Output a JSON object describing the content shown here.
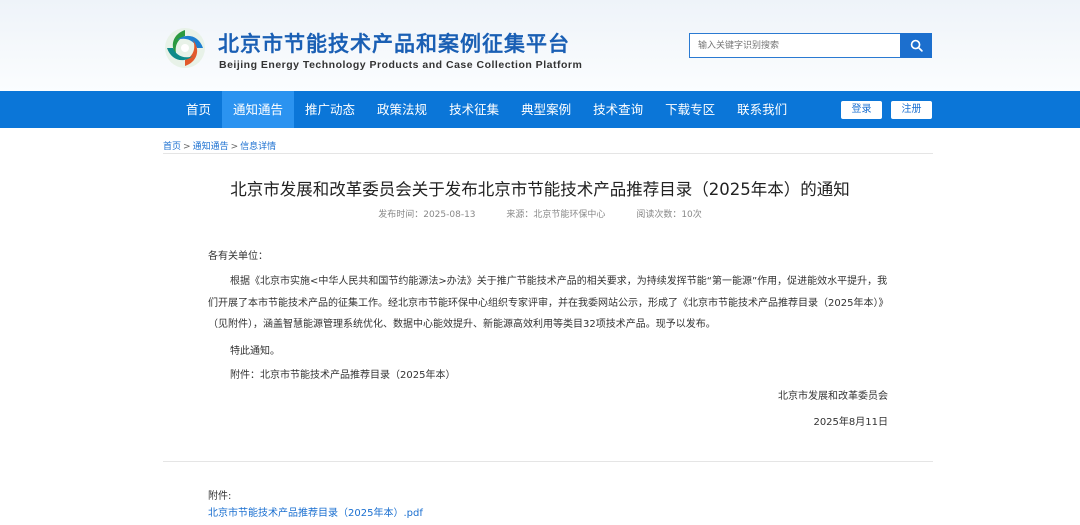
{
  "header": {
    "site_title": "北京市节能技术产品和案例征集平台",
    "site_subtitle": "Beijing Energy Technology Products and Case Collection Platform",
    "search_placeholder": "输入关键字识别搜索",
    "brand_color": "#1a5fb4"
  },
  "nav": {
    "items": [
      {
        "label": "首页",
        "active": false
      },
      {
        "label": "通知通告",
        "active": true
      },
      {
        "label": "推广动态",
        "active": false
      },
      {
        "label": "政策法规",
        "active": false
      },
      {
        "label": "技术征集",
        "active": false
      },
      {
        "label": "典型案例",
        "active": false
      },
      {
        "label": "技术查询",
        "active": false
      },
      {
        "label": "下载专区",
        "active": false
      },
      {
        "label": "联系我们",
        "active": false
      }
    ],
    "login_label": "登录",
    "register_label": "注册",
    "bar_color": "#0b76d8"
  },
  "breadcrumb": {
    "home": "首页",
    "section": "通知通告",
    "current": "信息详情",
    "separator": ">"
  },
  "article": {
    "title": "北京市发展和改革委员会关于发布北京市节能技术产品推荐目录（2025年本）的通知",
    "publish_time": "发布时间：2025-08-13",
    "source": "来源：北京节能环保中心",
    "views": "阅读次数：10次",
    "salutation": "各有关单位：",
    "body": "根据《北京市实施<中华人民共和国节约能源法>办法》关于推广节能技术产品的相关要求，为持续发挥节能“第一能源”作用，促进能效水平提升，我们开展了本市节能技术产品的征集工作。经北京市节能环保中心组织专家评审，并在我委网站公示，形成了《北京市节能技术产品推荐目录（2025年本）》（见附件），涵盖智慧能源管理系统优化、数据中心能效提升、新能源高效利用等类目32项技术产品。现予以发布。",
    "notice": "特此通知。",
    "attachment_line": "附件：北京市节能技术产品推荐目录（2025年本）",
    "signature_org": "北京市发展和改革委员会",
    "signature_date": "2025年8月11日"
  },
  "attachments": {
    "label": "附件:",
    "file": "北京市节能技术产品推荐目录（2025年本）.pdf"
  }
}
